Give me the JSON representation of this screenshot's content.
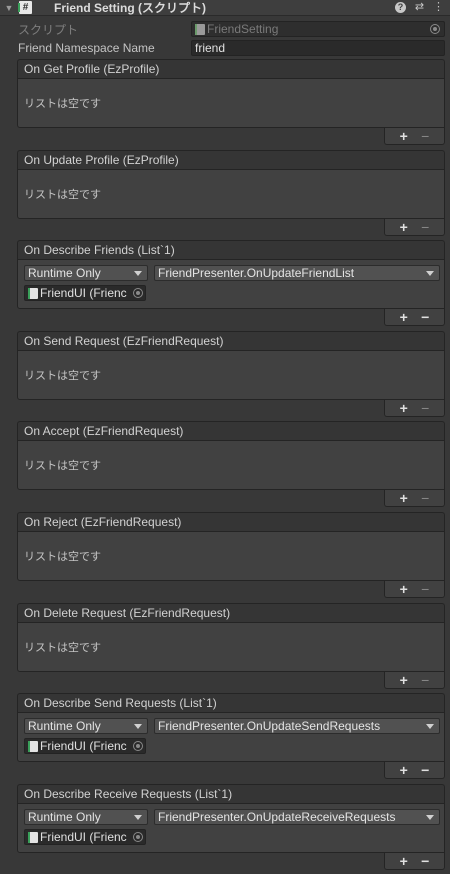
{
  "header": {
    "title": "Friend Setting (スクリプト)"
  },
  "script_field": {
    "label": "スクリプト",
    "value": "FriendSetting"
  },
  "namespace_field": {
    "label": "Friend Namespace Name",
    "value": "friend"
  },
  "empty_list_text": "リストは空です",
  "events": [
    {
      "title": "On Get Profile (EzProfile)",
      "empty": true
    },
    {
      "title": "On Update Profile (EzProfile)",
      "empty": true
    },
    {
      "title": "On Describe Friends (List`1)",
      "empty": false,
      "mode": "Runtime Only",
      "function": "FriendPresenter.OnUpdateFriendList",
      "target": "FriendUI (Frienc"
    },
    {
      "title": "On Send Request (EzFriendRequest)",
      "empty": true
    },
    {
      "title": "On Accept (EzFriendRequest)",
      "empty": true
    },
    {
      "title": "On Reject (EzFriendRequest)",
      "empty": true
    },
    {
      "title": "On Delete Request (EzFriendRequest)",
      "empty": true
    },
    {
      "title": "On Describe Send Requests (List`1)",
      "empty": false,
      "mode": "Runtime Only",
      "function": "FriendPresenter.OnUpdateSendRequests",
      "target": "FriendUI (Frienc"
    },
    {
      "title": "On Describe Receive Requests (List`1)",
      "empty": false,
      "mode": "Runtime Only",
      "function": "FriendPresenter.OnUpdateReceiveRequests",
      "target": "FriendUI (Frienc"
    }
  ],
  "footer": {
    "plus": "+",
    "minus": "−"
  }
}
